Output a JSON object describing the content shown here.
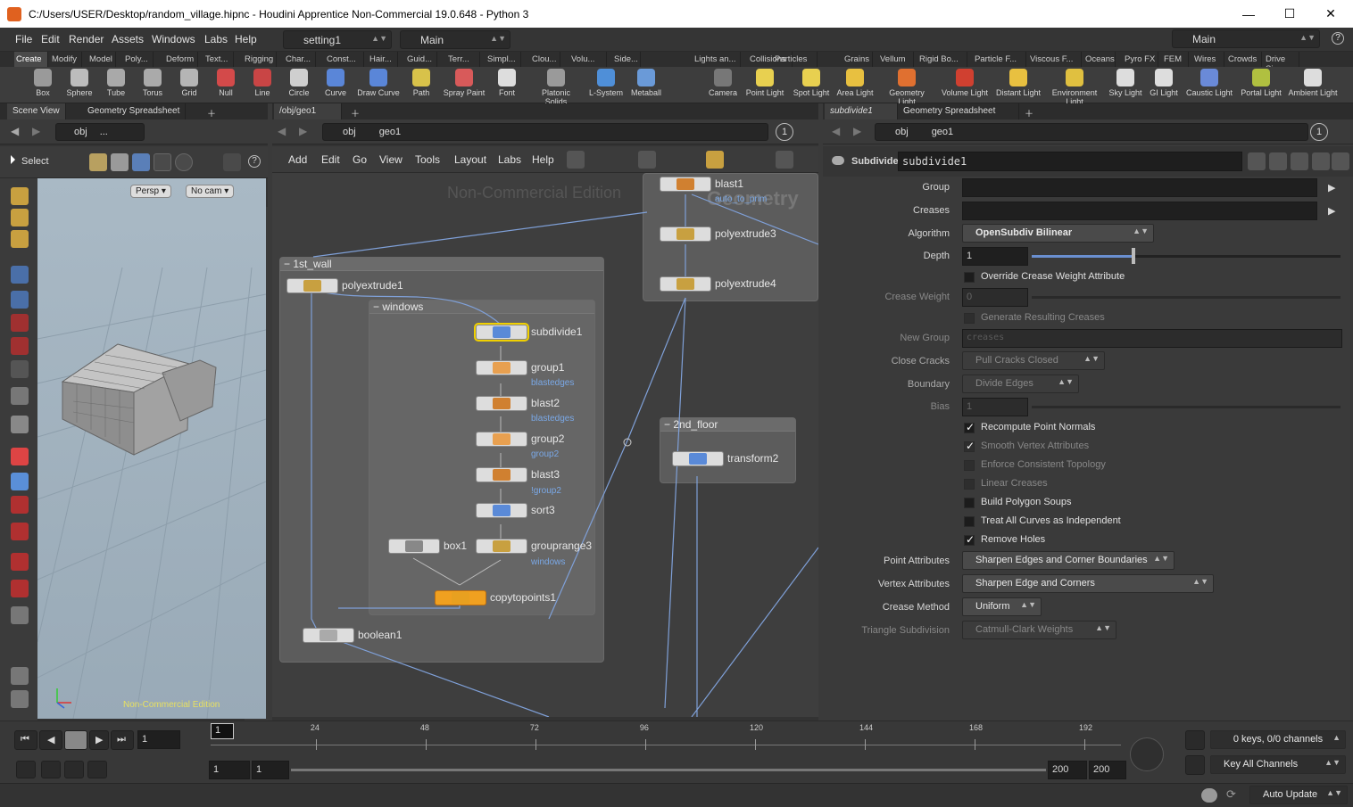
{
  "window": {
    "title": "C:/Users/USER/Desktop/random_village.hipnc - Houdini Apprentice Non-Commercial 19.0.648 - Python 3",
    "min": "—",
    "max": "☐",
    "close": "✕"
  },
  "menubar": {
    "items": [
      "File",
      "Edit",
      "Render",
      "Assets",
      "Windows",
      "Labs",
      "Help"
    ],
    "desktop": "setting1",
    "layout": "Main",
    "rightdesk": "Main",
    "help": "?"
  },
  "shelf_tabs_left": [
    "Create",
    "Modify",
    "Model",
    "Poly...",
    "Deform",
    "Text...",
    "Rigging",
    "Char...",
    "Const...",
    "Hair...",
    "Guid...",
    "Terr...",
    "Simpl...",
    "Clou...",
    "Volu...",
    "Side..."
  ],
  "shelf_tabs_right": [
    "Lights an...",
    "Collisions",
    "Particles",
    "Grains",
    "Vellum",
    "Rigid Bo...",
    "Particle F...",
    "Viscous F...",
    "Oceans",
    "Pyro FX",
    "FEM",
    "Wires",
    "Crowds",
    "Drive Si..."
  ],
  "tools_left": [
    {
      "label": "Box",
      "color": "#9a9a9a"
    },
    {
      "label": "Sphere",
      "color": "#bcbcbc"
    },
    {
      "label": "Tube",
      "color": "#a9a9a9"
    },
    {
      "label": "Torus",
      "color": "#aaaaaa"
    },
    {
      "label": "Grid",
      "color": "#b5b5b5"
    },
    {
      "label": "Null",
      "color": "#d34a4a"
    },
    {
      "label": "Line",
      "color": "#c94545"
    },
    {
      "label": "Circle",
      "color": "#cfcfcf"
    },
    {
      "label": "Curve",
      "color": "#5a86d8"
    },
    {
      "label": "Draw Curve",
      "color": "#5a86d8"
    },
    {
      "label": "Path",
      "color": "#d8c24a"
    },
    {
      "label": "Spray Paint",
      "color": "#d85a5a"
    },
    {
      "label": "Font",
      "color": "#dddddd"
    },
    {
      "label": "Platonic Solids",
      "color": "#9a9a9a"
    },
    {
      "label": "L-System",
      "color": "#4f8fd8"
    },
    {
      "label": "Metaball",
      "color": "#6a9ad8"
    }
  ],
  "tools_right": [
    {
      "label": "Camera",
      "color": "#777777"
    },
    {
      "label": "Point Light",
      "color": "#e8d050"
    },
    {
      "label": "Spot Light",
      "color": "#e8d050"
    },
    {
      "label": "Area Light",
      "color": "#e8c040"
    },
    {
      "label": "Geometry Light",
      "color": "#e07030"
    },
    {
      "label": "Volume Light",
      "color": "#d04030"
    },
    {
      "label": "Distant Light",
      "color": "#e8c040"
    },
    {
      "label": "Environment Light",
      "color": "#e0c040"
    },
    {
      "label": "Sky Light",
      "color": "#dddddd"
    },
    {
      "label": "GI Light",
      "color": "#dddddd"
    },
    {
      "label": "Caustic Light",
      "color": "#6a8ad8"
    },
    {
      "label": "Portal Light",
      "color": "#b0c040"
    },
    {
      "label": "Ambient Light",
      "color": "#dddddd"
    }
  ],
  "viewer": {
    "tabs": [
      "Scene View",
      "Geometry Spreadsheet"
    ],
    "path": "obj",
    "path2": "...",
    "select": "Select",
    "persp": "Persp ▾",
    "cam": "No cam ▾",
    "watermark": "Non-Commercial Edition"
  },
  "network": {
    "tabs": [
      "/obj/geo1"
    ],
    "path_obj": "obj",
    "path_geo": "geo1",
    "badge": "1",
    "menus": [
      "Add",
      "Edit",
      "Go",
      "View",
      "Tools",
      "Layout",
      "Labs",
      "Help"
    ],
    "watermark1": "Non-Commercial Edition",
    "watermark2": "Geometry"
  },
  "groups": {
    "wall": "1st_wall",
    "windows": "windows",
    "floor": "2nd_floor"
  },
  "nodes": {
    "blast1": "blast1",
    "blast1_sub": "auto_to_prim",
    "polyextrude3": "polyextrude3",
    "polyextrude4": "polyextrude4",
    "polyextrude1": "polyextrude1",
    "subdivide1": "subdivide1",
    "group1": "group1",
    "blastedges1": "blastedges",
    "blast2": "blast2",
    "blastedges2": "blastedges",
    "group2": "group2",
    "group2_sub": "group2",
    "blast3": "blast3",
    "blast3_sub": "!group2",
    "sort3": "sort3",
    "box1": "box1",
    "grouprange3": "grouprange3",
    "grouprange3_sub": "windows",
    "copytopoints1": "copytopoints1",
    "boolean1": "boolean1",
    "transform2": "transform2"
  },
  "params": {
    "tabs": [
      "subdivide1",
      "Geometry Spreadsheet"
    ],
    "path_obj": "obj",
    "path_geo": "geo1",
    "badge": "1",
    "type": "Subdivide",
    "name": "subdivide1",
    "group_label": "Group",
    "creases_label": "Creases",
    "algorithm_label": "Algorithm",
    "algorithm": "OpenSubdiv Bilinear",
    "depth_label": "Depth",
    "depth": "1",
    "override_label": "Override Crease Weight Attribute",
    "crease_weight_label": "Crease Weight",
    "crease_weight": "0",
    "gen_creases_label": "Generate Resulting Creases",
    "new_group_label": "New Group",
    "new_group": "creases",
    "close_cracks_label": "Close Cracks",
    "close_cracks": "Pull Cracks Closed",
    "boundary_label": "Boundary",
    "boundary": "Divide Edges",
    "bias_label": "Bias",
    "bias": "1",
    "recompute": "Recompute Point Normals",
    "smooth": "Smooth Vertex Attributes",
    "enforce": "Enforce Consistent Topology",
    "linear": "Linear Creases",
    "build": "Build Polygon Soups",
    "treat": "Treat All Curves as Independent",
    "remove": "Remove Holes",
    "point_attr_label": "Point Attributes",
    "point_attr": "Sharpen Edges and Corner Boundaries",
    "vertex_attr_label": "Vertex Attributes",
    "vertex_attr": "Sharpen Edge and Corners",
    "crease_method_label": "Crease Method",
    "crease_method": "Uniform",
    "tri_label": "Triangle Subdivision",
    "tri": "Catmull-Clark Weights"
  },
  "timeline": {
    "frame": "1",
    "marker": "1",
    "ticks": [
      "24",
      "48",
      "72",
      "96",
      "120",
      "144",
      "168",
      "192"
    ],
    "start": "1",
    "start2": "1",
    "end": "200",
    "end2": "200",
    "keys": "0 keys, 0/0 channels",
    "key_all": "Key All Channels"
  },
  "status": {
    "auto_update": "Auto Update"
  }
}
